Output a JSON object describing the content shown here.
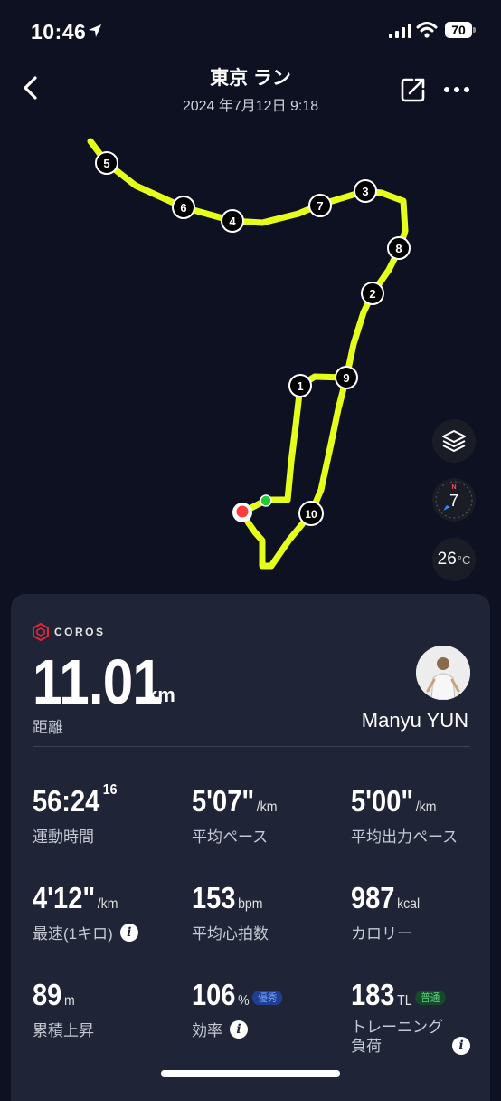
{
  "status_bar": {
    "time": "10:46",
    "battery": "70"
  },
  "header": {
    "title": "東京 ラン",
    "subtitle": "2024 年7月12日 9:18"
  },
  "map": {
    "markers": [
      "5",
      "6",
      "4",
      "7",
      "3",
      "8",
      "2",
      "9",
      "1",
      "10"
    ],
    "compass_value": "7",
    "compass_north": "N",
    "temperature": "26",
    "temperature_unit": "°C"
  },
  "summary": {
    "brand": "COROS",
    "distance": "11.01",
    "distance_unit": "km",
    "distance_label": "距離",
    "user_name": "Manyu YUN"
  },
  "metrics": [
    {
      "value": "56:24",
      "sup": "16",
      "unit": "",
      "label": "運動時間"
    },
    {
      "value": "5'07\"",
      "unit": "/km",
      "label": "平均ペース"
    },
    {
      "value": "5'00\"",
      "unit": "/km",
      "label": "平均出力ペース"
    },
    {
      "value": "4'12\"",
      "unit": "/km",
      "label": "最速(1キロ)"
    },
    {
      "value": "153",
      "unit": "bpm",
      "label": "平均心拍数"
    },
    {
      "value": "987",
      "unit": "kcal",
      "label": "カロリー"
    },
    {
      "value": "89",
      "unit": "m",
      "label": "累積上昇"
    },
    {
      "value": "106",
      "unit": "%",
      "badge": "優秀",
      "label": "効率"
    },
    {
      "value": "183",
      "unit": "TL",
      "badge": "普通",
      "label": "トレーニング\n負荷"
    }
  ],
  "colors": {
    "route": "#e5ff1a",
    "background": "#0d1121",
    "card": "#1f2436",
    "start": "#22cc33",
    "end": "#ff3b3b"
  },
  "icons": [
    "location-arrow-icon",
    "signal-icon",
    "wifi-icon",
    "battery-icon",
    "back-chevron-icon",
    "share-icon",
    "more-dots-icon",
    "layers-icon",
    "compass-icon",
    "info-icon"
  ]
}
